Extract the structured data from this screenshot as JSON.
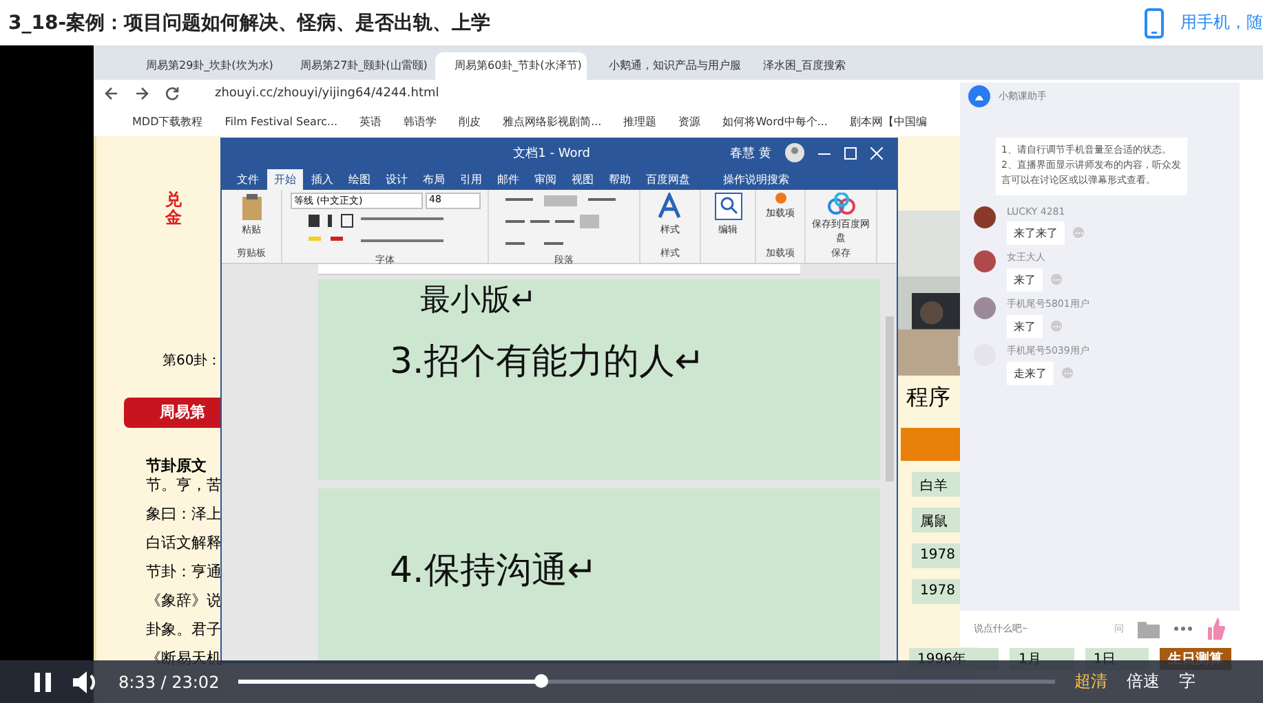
{
  "header": {
    "title": "3_18-案例：项目问题如何解决、怪病、是否出轨、上学",
    "phone_link": "用手机，随"
  },
  "browser": {
    "tabs": [
      {
        "label": "周易第29卦_坎卦(坎为水)",
        "selected": false
      },
      {
        "label": "周易第27卦_颐卦(山雷颐)",
        "selected": false
      },
      {
        "label": "周易第60卦_节卦(水泽节)",
        "selected": true
      },
      {
        "label": "小鹅通，知识产品与用户服",
        "selected": false
      },
      {
        "label": "泽水困_百度搜索",
        "selected": false
      }
    ],
    "url": "zhouyi.cc/zhouyi/yijing64/4244.html",
    "bookmarks": [
      "MDD下载教程",
      "Film Festival Searc...",
      "英语",
      "韩语学",
      "削皮",
      "雅点网络影视剧简...",
      "推理题",
      "资源",
      "如何将Word中每个...",
      "剧本网【中国编"
    ]
  },
  "web_page": {
    "element": "兑金",
    "gua_label": "第60卦：",
    "banner": "周易第",
    "heading": "节卦原文",
    "lines": [
      "节。亨，苦",
      "象曰：泽上",
      "白话文解释",
      "节卦：亨通",
      "《象辞》说",
      "卦象。君子",
      "《断易天机"
    ]
  },
  "word": {
    "title": "文档1 - Word",
    "user": "春慧 黄",
    "tabs": [
      {
        "label": "文件",
        "selected": false
      },
      {
        "label": "开始",
        "selected": true
      },
      {
        "label": "插入",
        "selected": false
      },
      {
        "label": "绘图",
        "selected": false
      },
      {
        "label": "设计",
        "selected": false
      },
      {
        "label": "布局",
        "selected": false
      },
      {
        "label": "引用",
        "selected": false
      },
      {
        "label": "邮件",
        "selected": false
      },
      {
        "label": "审阅",
        "selected": false
      },
      {
        "label": "视图",
        "selected": false
      },
      {
        "label": "帮助",
        "selected": false
      },
      {
        "label": "百度网盘",
        "selected": false
      }
    ],
    "search": "操作说明搜索",
    "font": "等线 (中文正文)",
    "size": "48",
    "groups": [
      {
        "label": "剪贴板",
        "button": "粘贴"
      },
      {
        "label": "字体"
      },
      {
        "label": "段落"
      },
      {
        "label": "样式",
        "button": "样式"
      },
      {
        "button": "编辑"
      },
      {
        "label": "加载项",
        "button": "加载项"
      },
      {
        "label": "保存",
        "button": "保存到百度网盘"
      }
    ],
    "pages": [
      [
        "最小版↵",
        "3.招个有能力的人↵"
      ],
      [
        "4.保持沟通↵"
      ]
    ]
  },
  "side_page": {
    "title": "程序",
    "rows": [
      "白羊",
      "属鼠",
      "1978",
      "1978"
    ],
    "selects": [
      "1996年",
      "1月",
      "1日"
    ],
    "button": "生日测算"
  },
  "chat": {
    "sender": "小鹅课助手",
    "notice": "1、请自行调节手机音量至合适的状态。\n2、直播界面显示讲师发布的内容，听众发言可以在讨论区或以弹幕形式查看。",
    "messages": [
      {
        "user": "LUCKY 4281",
        "text": "来了来了",
        "color": "#8a3a2a"
      },
      {
        "user": "女王大人",
        "text": "来了",
        "color": "#b04a4a"
      },
      {
        "user": "手机尾号5801用户",
        "text": "来了",
        "color": "#9a8a9a"
      },
      {
        "user": "手机尾号5039用户",
        "text": "走来了",
        "color": "#e4e4ea"
      }
    ],
    "placeholder": "说点什么吧~",
    "ask": "问"
  },
  "player": {
    "playing": true,
    "time": "8:33 / 23:02",
    "level": 0.37,
    "quality": "超清",
    "speed": "倍速",
    "subtitles": "字"
  }
}
